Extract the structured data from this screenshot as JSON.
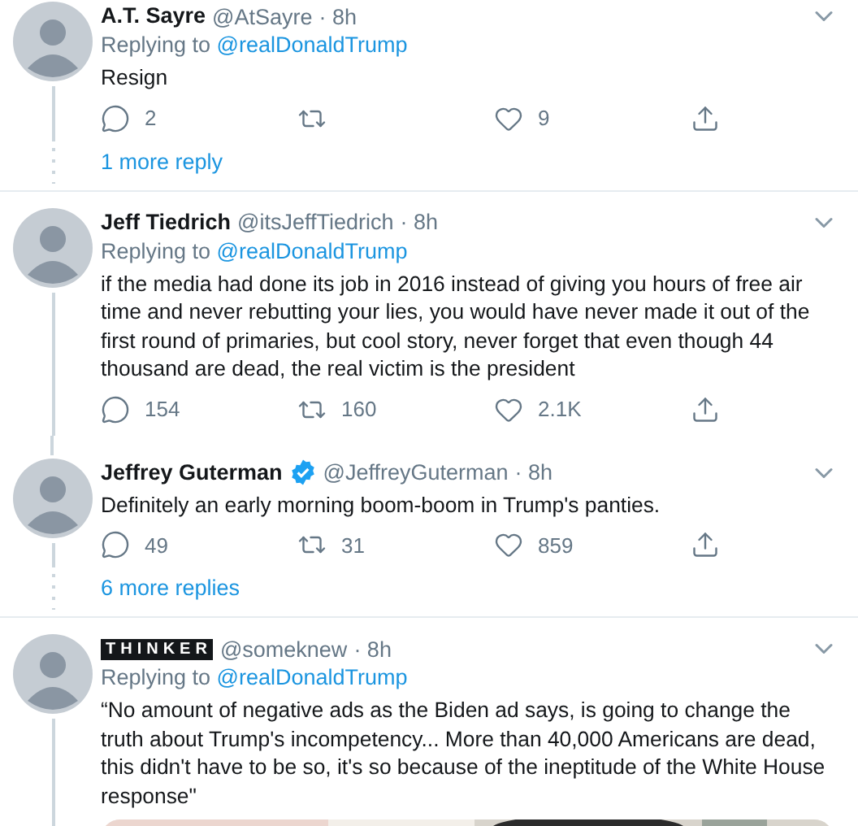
{
  "tweets": [
    {
      "name": {
        "text": "A.T. Sayre",
        "kind": "plain"
      },
      "verified": false,
      "handle": "@AtSayre",
      "time": "· 8h",
      "replying_prefix": "Replying to ",
      "replying_to": "@realDonaldTrump",
      "text": "Resign",
      "actions": [
        {
          "kind": "reply",
          "count": "2"
        },
        {
          "kind": "retweet"
        },
        {
          "kind": "like",
          "count": "9"
        },
        {
          "kind": "share"
        }
      ],
      "more_replies": "1 more reply"
    },
    {
      "name": {
        "text": "Jeff Tiedrich",
        "kind": "plain"
      },
      "verified": false,
      "handle": "@itsJeffTiedrich",
      "time": "· 8h",
      "replying_prefix": "Replying to ",
      "replying_to": "@realDonaldTrump",
      "text": "if the media had done its job in 2016 instead of giving you hours of free air time and never rebutting your lies, you would have never made it out of the first round of primaries, but cool story, never forget that even though 44 thousand are dead, the real victim is the president",
      "connected_above": false,
      "actions": [
        {
          "kind": "reply",
          "count": "154"
        },
        {
          "kind": "retweet",
          "count": "160"
        },
        {
          "kind": "like",
          "count": "2.1K"
        },
        {
          "kind": "share"
        }
      ]
    },
    {
      "name": {
        "text": "Jeffrey Guterman",
        "kind": "plain"
      },
      "verified": true,
      "handle": "@JeffreyGuterman",
      "time": "· 8h",
      "text": "Definitely an early morning boom-boom in Trump's panties.",
      "connected_above": true,
      "actions": [
        {
          "kind": "reply",
          "count": "49"
        },
        {
          "kind": "retweet",
          "count": "31"
        },
        {
          "kind": "like",
          "count": "859"
        },
        {
          "kind": "share"
        }
      ],
      "more_replies": "6 more replies"
    },
    {
      "name": {
        "text": "THINKER",
        "kind": "inverted"
      },
      "verified": false,
      "handle": "@someknew",
      "time": "· 8h",
      "replying_prefix": "Replying to ",
      "replying_to": "@realDonaldTrump",
      "text": "“No amount of negative ads as the Biden ad says, is going to change the truth about Trump's incompetency... More than 40,000 Americans are dead, this didn't have to be so, it's so because of the ineptitude of the White House response\"",
      "connected_above": false
    }
  ]
}
